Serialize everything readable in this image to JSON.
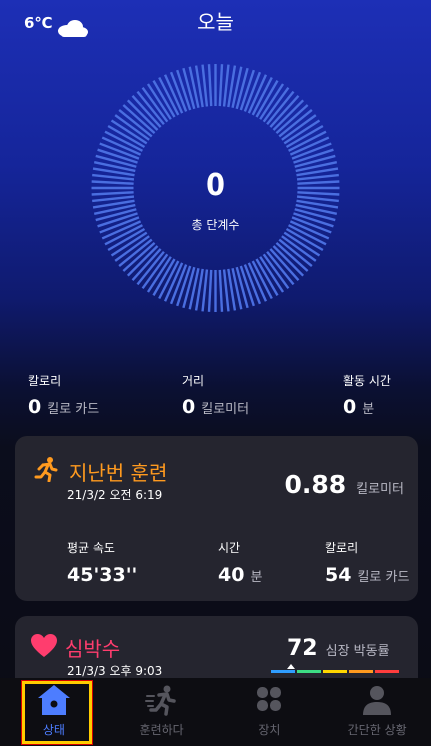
{
  "header": {
    "temperature": "6℃",
    "weather_icon": "cloud-icon",
    "title": "오늘"
  },
  "steps": {
    "value": "0",
    "label": "총 단계수"
  },
  "stats": [
    {
      "label": "칼로리",
      "value": "0",
      "unit": "킬로 카드"
    },
    {
      "label": "거리",
      "value": "0",
      "unit": "킬로미터"
    },
    {
      "label": "활동 시간",
      "value": "0",
      "unit": "분"
    }
  ],
  "training": {
    "title": "지난번 훈련",
    "date": "21/3/2 오전 6:19",
    "distance_value": "0.88",
    "distance_unit": "킬로미터",
    "metrics": [
      {
        "label": "평균 속도",
        "value": "45'33''",
        "unit": ""
      },
      {
        "label": "시간",
        "value": "40",
        "unit": "분"
      },
      {
        "label": "칼로리",
        "value": "54",
        "unit": "킬로 카드"
      }
    ],
    "accent_color": "#ff9a1f"
  },
  "heart": {
    "title": "심박수",
    "date": "21/3/3 오후 9:03",
    "value": "72",
    "unit": "심장 박동률",
    "accent_color": "#ff3d6e",
    "zone_colors": [
      "#2f9dff",
      "#3ddc84",
      "#ffd600",
      "#ff9a1f",
      "#ff3d3d"
    ]
  },
  "nav": {
    "items": [
      {
        "label": "상태",
        "icon": "home-icon",
        "active": true
      },
      {
        "label": "훈련하다",
        "icon": "running-icon",
        "active": false
      },
      {
        "label": "장치",
        "icon": "device-grid-icon",
        "active": false
      },
      {
        "label": "간단한 상황",
        "icon": "profile-icon",
        "active": false
      }
    ],
    "active_color": "#4d7dff"
  }
}
